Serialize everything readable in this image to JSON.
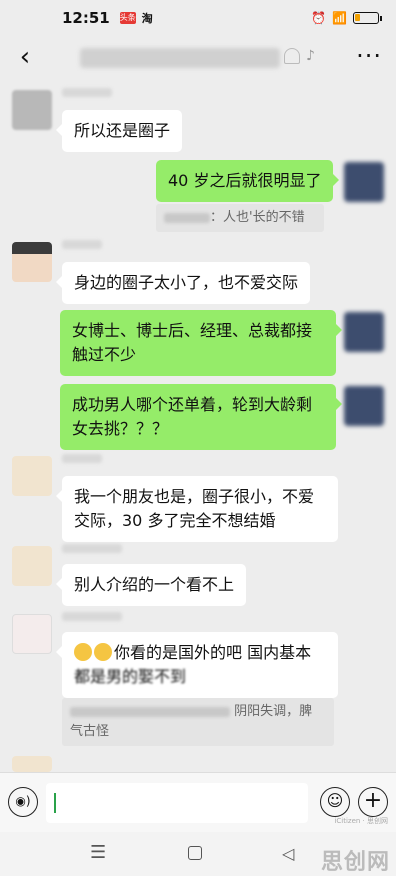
{
  "status_bar": {
    "time": "12:51",
    "badge1": "头条",
    "badge2": "淘",
    "battery_level": 0.2
  },
  "header": {
    "back_icon": "‹",
    "more_icon": "···"
  },
  "messages": [
    {
      "text": "所以还是圈子"
    },
    {
      "text": "40 岁之后就很明显了"
    },
    {
      "quote_suffix": "：人也'长的不错"
    },
    {
      "text": "身边的圈子太小了，也不爱交际"
    },
    {
      "line1": "女博士、博士后、经理、总裁都接",
      "line2": "触过不少"
    },
    {
      "line1": "成功男人哪个还单着，轮到大龄剩",
      "line2": "女去挑？？？"
    },
    {
      "line1": "我一个朋友也是，圈子很小，不爱",
      "line2": "交际，30 多了完全不想结婚"
    },
    {
      "text": "别人介绍的一个看不上"
    },
    {
      "line1": "你看的是国外的吧 国内基本",
      "line2": "都是男的娶不到"
    },
    {
      "quote_part1": "阴阳失调，脾",
      "quote_part2": "气古怪"
    }
  ],
  "input": {
    "voice_icon": "◉)",
    "emoji_icon": "☺",
    "plus_icon": "+"
  },
  "navbar": {
    "menu_icon": "☰",
    "back_icon": "◁"
  },
  "watermark": {
    "brand": "思创网",
    "sub": "iCitizen · 思创网"
  }
}
